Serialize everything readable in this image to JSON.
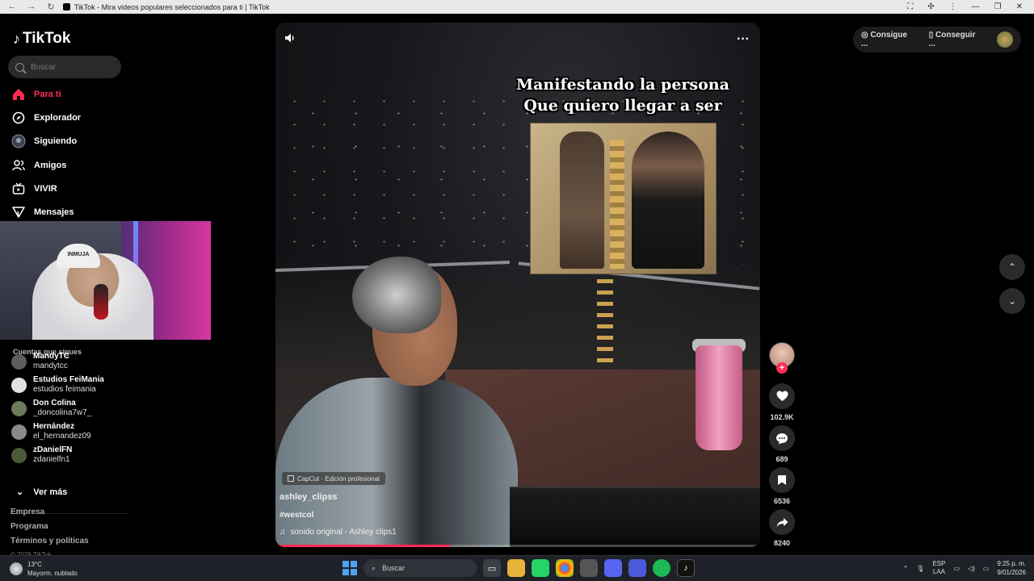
{
  "browser": {
    "tab_title": "TikTok - Mira videos populares seleccionados para ti | TikTok"
  },
  "sidebar": {
    "logo": "TikTok",
    "search_placeholder": "Buscar",
    "nav": [
      {
        "label": "Para ti",
        "icon": "home-icon",
        "active": true
      },
      {
        "label": "Explorador",
        "icon": "compass-icon"
      },
      {
        "label": "Siguiendo",
        "icon": "following-avatar-icon"
      },
      {
        "label": "Amigos",
        "icon": "friends-icon"
      },
      {
        "label": "VIVIR",
        "icon": "live-icon"
      },
      {
        "label": "Mensajes",
        "icon": "messages-icon"
      }
    ],
    "following_title": "Cuentas que sigues",
    "accounts": [
      {
        "name": "MandyTC",
        "handle": "mandytcc"
      },
      {
        "name": "Estudios FeiMania",
        "handle": "estudios feimania"
      },
      {
        "name": "Don Colina",
        "handle": "_doncolina7w7_"
      },
      {
        "name": "Hernández",
        "handle": "el_hernandez09"
      },
      {
        "name": "zDanielFN",
        "handle": "zdanielfn1"
      }
    ],
    "see_more": "Ver más",
    "footer_links": [
      "Empresa",
      "Programa",
      "Términos y políticas"
    ],
    "copyright": "© 2026 TikTok"
  },
  "webcam": {
    "cap_text": "INMUJA"
  },
  "video": {
    "overlay_line1": "Manifestando la persona",
    "overlay_line2": "Que quiero llegar a ser",
    "capcut_label": "CapCut · Edición profesional",
    "author": "ashley_clipss",
    "hashtag": "#westcol",
    "sound": "sonido original - Ashley clips1",
    "progress": 0.36
  },
  "actions": {
    "likes": "102.9K",
    "comments": "689",
    "saves": "6536",
    "shares": "8240"
  },
  "topright": {
    "coins_label": "Consigue ...",
    "app_label": "Conseguir ..."
  },
  "taskbar": {
    "temp": "13°C",
    "weather": "Mayorm. nublado",
    "search_label": "Buscar",
    "lang1": "ESP",
    "lang2": "LAA",
    "time": "9:25 p. m.",
    "date": "9/01/2026"
  },
  "colors": {
    "accent": "#fe2c55",
    "background": "#000000"
  }
}
